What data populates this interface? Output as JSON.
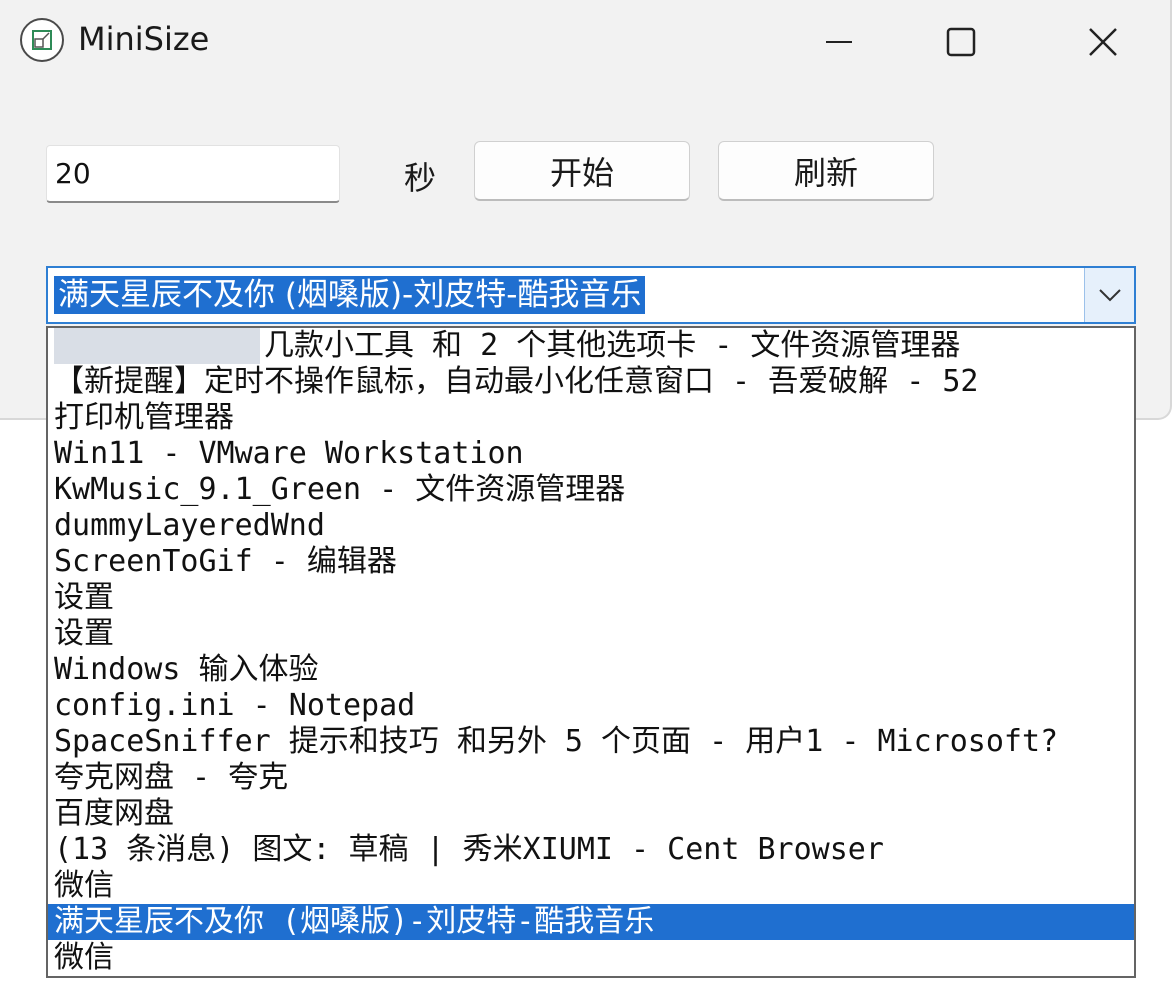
{
  "window": {
    "title": "MiniSize",
    "icon": "app-icon",
    "controls": [
      "minimize-icon",
      "maximize-icon",
      "close-icon"
    ]
  },
  "timer": {
    "value": "20",
    "unit_label": "秒"
  },
  "buttons": {
    "start_label": "开始",
    "refresh_label": "刷新"
  },
  "window_select": {
    "selected": "满天星辰不及你 (烟嗓版)-刘皮特-酷我音乐",
    "options": [
      "几款小工具 和 2 个其他选项卡 - 文件资源管理器",
      "【新提醒】定时不操作鼠标，自动最小化任意窗口 - 吾爱破解 - 52",
      "打印机管理器",
      "Win11 - VMware Workstation",
      "KwMusic_9.1_Green - 文件资源管理器",
      "dummyLayeredWnd",
      "ScreenToGif - 编辑器",
      "设置",
      "设置",
      "Windows 输入体验",
      "config.ini - Notepad",
      "SpaceSniffer 提示和技巧 和另外 5 个页面 - 用户1 - Microsoft?",
      "夸克网盘 - 夸克",
      "百度网盘",
      "(13 条消息) 图文: 草稿 | 秀米XIUMI - Cent Browser",
      "微信",
      "满天星辰不及你 (烟嗓版)-刘皮特-酷我音乐",
      "微信"
    ],
    "selected_index": 16,
    "redacted_index": 0
  },
  "colors": {
    "selection": "#1f6fd0",
    "focus_border": "#2f7fd3",
    "window_bg": "#f2f2f2"
  }
}
